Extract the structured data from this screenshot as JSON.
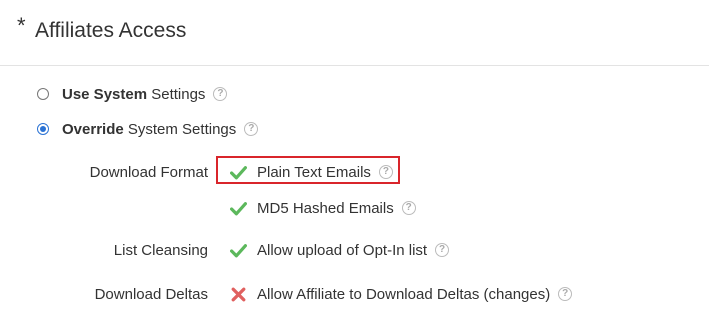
{
  "header": {
    "required_marker": "*",
    "title": "Affiliates Access"
  },
  "settings_mode": {
    "use_system": {
      "bold_text": "Use System",
      "rest_text": " Settings",
      "selected": false
    },
    "override": {
      "bold_text": "Override",
      "rest_text": " System Settings",
      "selected": true
    }
  },
  "fields": {
    "download_format": {
      "label": "Download Format",
      "options": [
        {
          "label": "Plain Text Emails",
          "enabled": true,
          "icon": "check-icon"
        },
        {
          "label": "MD5 Hashed Emails",
          "enabled": true,
          "icon": "check-icon"
        }
      ]
    },
    "list_cleansing": {
      "label": "List Cleansing",
      "options": [
        {
          "label": "Allow upload of Opt-In list",
          "enabled": true,
          "icon": "check-icon"
        }
      ]
    },
    "download_deltas": {
      "label": "Download Deltas",
      "options": [
        {
          "label": "Allow Affiliate to Download Deltas (changes)",
          "enabled": false,
          "icon": "cross-icon"
        }
      ]
    }
  },
  "help_glyph": "?",
  "colors": {
    "check": "#5cb85c",
    "cross": "#e0605f",
    "radio_selected": "#2a72d4",
    "highlight": "#d9252b"
  }
}
